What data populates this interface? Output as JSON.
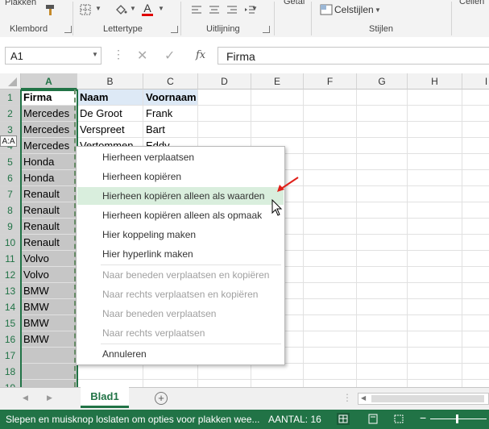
{
  "ribbon": {
    "plakken_label": "Plakken",
    "groups": [
      "Klembord",
      "Lettertype",
      "Uitlijning",
      "Stijlen"
    ],
    "getal_label": "Getal",
    "celstijlen_label": "Celstijlen",
    "cellen_label": "Cellen",
    "font_color": "#e00000"
  },
  "formula_bar": {
    "name_box": "A1",
    "fx_label": "fx",
    "formula": "Firma"
  },
  "columns": [
    "A",
    "B",
    "C",
    "D",
    "E",
    "F",
    "G",
    "H",
    "I"
  ],
  "rows": [
    "1",
    "2",
    "3",
    "4",
    "5",
    "6",
    "7",
    "8",
    "9",
    "10",
    "11",
    "12",
    "13",
    "14",
    "15",
    "16",
    "17",
    "18",
    "19"
  ],
  "cells": {
    "A": [
      "Firma",
      "Mercedes",
      "Mercedes",
      "Mercedes",
      "Honda",
      "Honda",
      "Renault",
      "Renault",
      "Renault",
      "Renault",
      "Volvo",
      "Volvo",
      "BMW",
      "BMW",
      "BMW",
      "BMW"
    ],
    "B": [
      "Naam",
      "De Groot",
      "Verspreet",
      "Vertommen"
    ],
    "C": [
      "Voornaam",
      "Frank",
      "Bart",
      "Eddy"
    ]
  },
  "drag_tooltip": "A:A",
  "context_menu": {
    "items": [
      {
        "label": "Hierheen verplaatsen",
        "enabled": true,
        "highlighted": false
      },
      {
        "label": "Hierheen kopiëren",
        "enabled": true,
        "highlighted": false
      },
      {
        "label": "Hierheen kopiëren alleen als waarden",
        "enabled": true,
        "highlighted": true
      },
      {
        "label": "Hierheen kopiëren alleen als opmaak",
        "enabled": true,
        "highlighted": false
      },
      {
        "label": "Hier koppeling maken",
        "enabled": true,
        "highlighted": false
      },
      {
        "label": "Hier hyperlink maken",
        "enabled": true,
        "highlighted": false
      },
      {
        "label": "Naar beneden verplaatsen en kopiëren",
        "enabled": false,
        "highlighted": false
      },
      {
        "label": "Naar rechts verplaatsen en kopiëren",
        "enabled": false,
        "highlighted": false
      },
      {
        "label": "Naar beneden verplaatsen",
        "enabled": false,
        "highlighted": false
      },
      {
        "label": "Naar rechts verplaatsen",
        "enabled": false,
        "highlighted": false
      },
      {
        "label": "Annuleren",
        "enabled": true,
        "highlighted": false
      }
    ]
  },
  "sheet_tabs": [
    "Blad1"
  ],
  "status_bar": {
    "message": "Slepen en muisknop loslaten om opties voor plakken wee...",
    "count": "AANTAL: 16"
  },
  "colors": {
    "excel_green": "#217346",
    "highlight": "#d9eedd",
    "annotation_arrow": "#e0201a"
  }
}
